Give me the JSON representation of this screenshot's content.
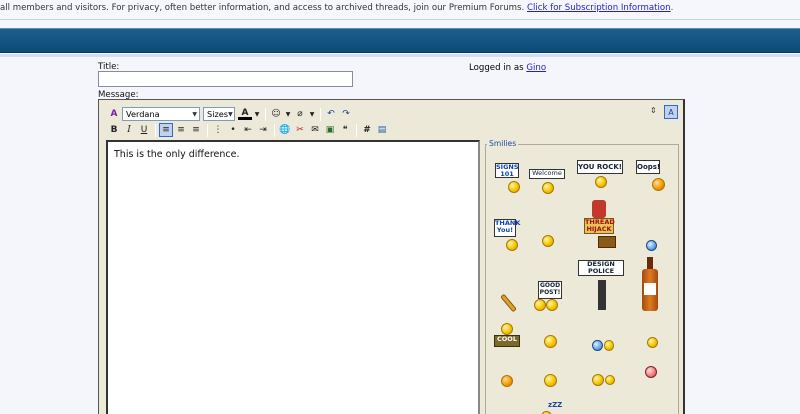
{
  "notice": {
    "text": "all members and visitors. For privacy, often better information, and access to archived threads, join our Premium Forums.",
    "link": "Click for Subscription Information",
    "tail": "."
  },
  "form": {
    "title_label": "Title:",
    "title_value": "",
    "logged_prefix": "Logged in as",
    "username": "Gino",
    "message_label": "Message:"
  },
  "toolbar": {
    "font": "Verdana",
    "size": "Sizes"
  },
  "message": {
    "text": "This is the only difference."
  },
  "smilies": {
    "title": "Smilies",
    "signs": {
      "sign101": "SIGNS 101",
      "welcome": "Welcome",
      "yourock": "YOU ROCK!",
      "oops": "Oops!",
      "thankyou": "THANK You!",
      "threadhijack": "THREAD HIJACK",
      "designpolice": "DESIGN POLICE",
      "goodpost": "GOOD POST!",
      "cool": "COOL",
      "zzz": "zZZ"
    }
  },
  "colors": {
    "banner": "#0b4a76",
    "link": "#2222cc",
    "editor_bg": "#ece9d8"
  }
}
